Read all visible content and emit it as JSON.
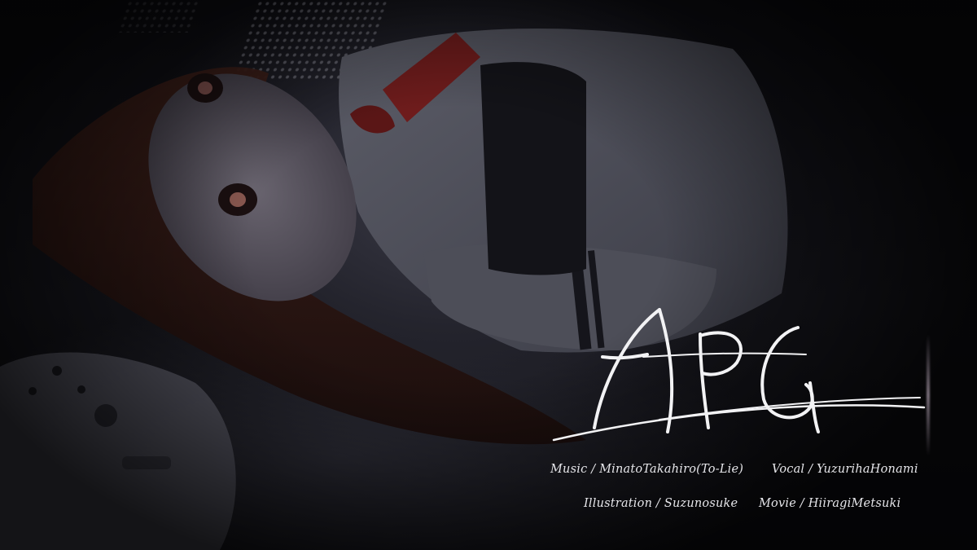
{
  "logo_text": "APG",
  "credits": {
    "music": "Music / MinatoTakahiro(To-Lie)",
    "vocal": "Vocal / YuzurihaHonami",
    "illustration": "Illustration / Suzunosuke",
    "movie": "Movie / HiiragiMetsuki"
  },
  "colors": {
    "background": "#101015",
    "text": "#e6e6ea",
    "ribbon": "#7a1e1e",
    "hair": "#3a1c16"
  }
}
